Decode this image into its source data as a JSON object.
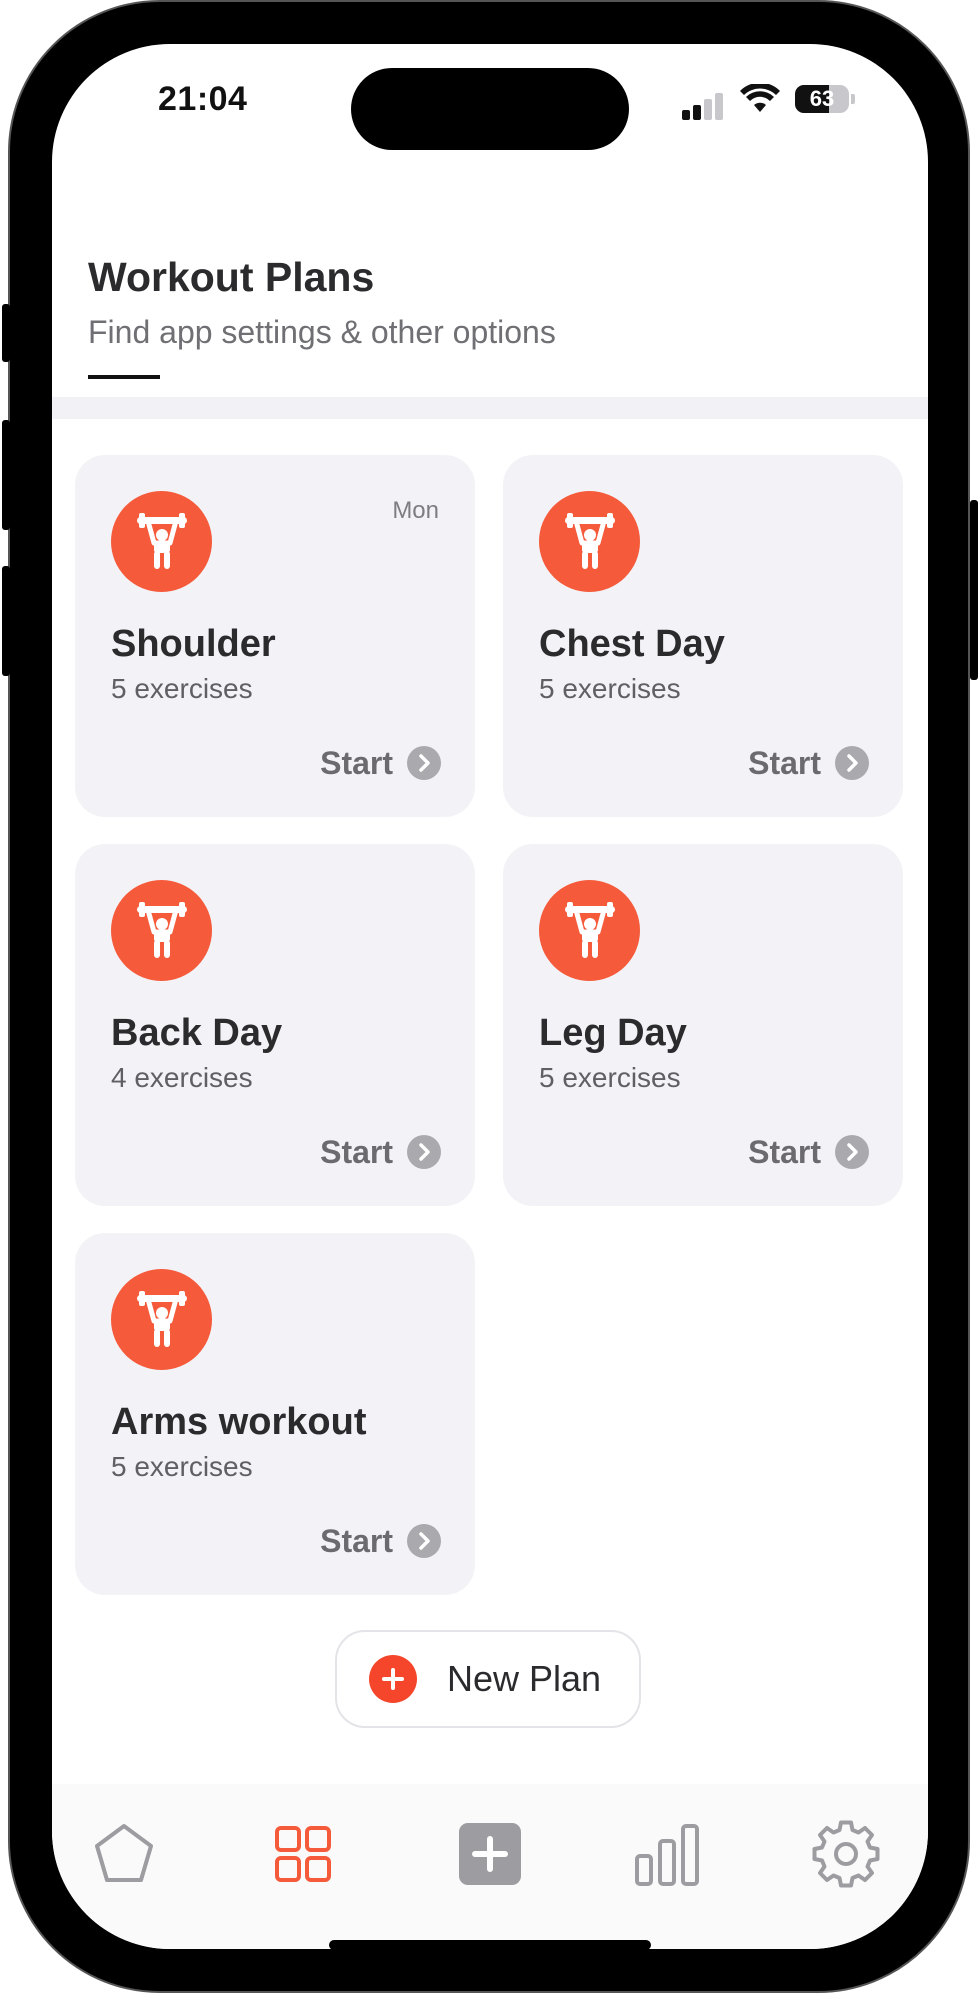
{
  "status_bar": {
    "time": "21:04",
    "battery": "63"
  },
  "header": {
    "title": "Workout Plans",
    "subtitle": "Find app settings & other options"
  },
  "plans": [
    {
      "name": "Shoulder",
      "count": "5 exercises",
      "day": "Mon",
      "start_label": "Start"
    },
    {
      "name": "Chest Day",
      "count": "5 exercises",
      "day": "",
      "start_label": "Start"
    },
    {
      "name": "Back Day",
      "count": "4 exercises",
      "day": "",
      "start_label": "Start"
    },
    {
      "name": "Leg Day",
      "count": "5 exercises",
      "day": "",
      "start_label": "Start"
    },
    {
      "name": "Arms workout",
      "count": "5 exercises",
      "day": "",
      "start_label": "Start"
    }
  ],
  "new_plan": {
    "label": "New Plan"
  },
  "tab_bar": {
    "items": [
      {
        "icon": "pentagon-icon",
        "active": false
      },
      {
        "icon": "grid-icon",
        "active": true
      },
      {
        "icon": "plus-square-icon",
        "active": false
      },
      {
        "icon": "bar-chart-icon",
        "active": false
      },
      {
        "icon": "gear-icon",
        "active": false
      }
    ]
  },
  "colors": {
    "accent": "#f55a3a",
    "card_bg": "#f3f3f7",
    "inactive_icon": "#9c9ca1"
  }
}
